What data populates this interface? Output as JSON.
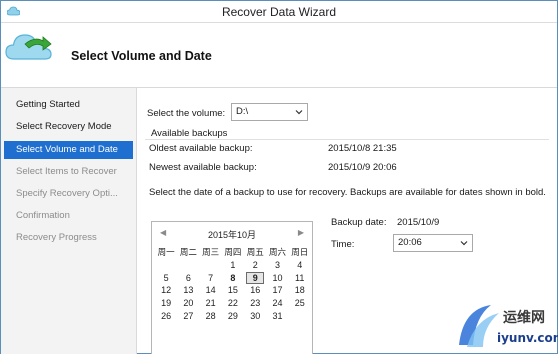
{
  "window": {
    "title": "Recover Data Wizard"
  },
  "header": {
    "title": "Select Volume and Date"
  },
  "steps": [
    {
      "label": "Getting Started",
      "state": "done"
    },
    {
      "label": "Select Recovery Mode",
      "state": "done"
    },
    {
      "label": "Select Volume and Date",
      "state": "active"
    },
    {
      "label": "Select Items to Recover",
      "state": "disabled"
    },
    {
      "label": "Specify Recovery Opti...",
      "state": "disabled"
    },
    {
      "label": "Confirmation",
      "state": "disabled"
    },
    {
      "label": "Recovery Progress",
      "state": "disabled"
    }
  ],
  "volume": {
    "label": "Select the volume:",
    "value": "D:\\"
  },
  "available": {
    "heading": "Available backups",
    "oldest_label": "Oldest available backup:",
    "oldest_value": "2015/10/8 21:35",
    "newest_label": "Newest available backup:",
    "newest_value": "2015/10/9 20:06"
  },
  "instruction": "Select the date of a backup to use for recovery. Backups are available for dates shown in bold.",
  "calendar": {
    "title": "2015年10月",
    "prev": "◀",
    "next": "▶",
    "weekdays": [
      "周一",
      "周二",
      "周三",
      "周四",
      "周五",
      "周六",
      "周日"
    ],
    "weeks": [
      [
        "",
        "",
        "",
        "1",
        "2",
        "3",
        "4"
      ],
      [
        "5",
        "6",
        "7",
        "8",
        "9",
        "10",
        "11"
      ],
      [
        "12",
        "13",
        "14",
        "15",
        "16",
        "17",
        "18"
      ],
      [
        "19",
        "20",
        "21",
        "22",
        "23",
        "24",
        "25"
      ],
      [
        "26",
        "27",
        "28",
        "29",
        "30",
        "31",
        ""
      ]
    ],
    "bold_days": [
      "8",
      "9"
    ],
    "selected_day": "9"
  },
  "backup_date": {
    "label": "Backup date:",
    "value": "2015/10/9"
  },
  "time": {
    "label": "Time:",
    "value": "20:06"
  },
  "watermark": {
    "cn": "运维网",
    "en": "iyunv.com"
  },
  "colors": {
    "accent": "#1f6fd0",
    "sidebar_bg": "#f3f3f3",
    "border": "#5b8fb9"
  },
  "icons": {
    "app": "backup-cloud-icon",
    "dropdown": "chevron-down-icon"
  }
}
